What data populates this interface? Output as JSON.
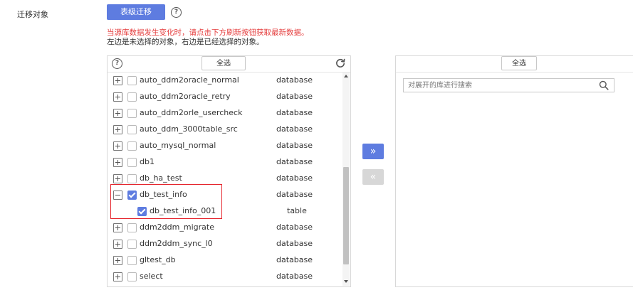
{
  "form": {
    "label": "迁移对象",
    "advanced_button": "表级迁移",
    "help_glyph": "?",
    "warning": "当源库数据发生变化时，请点击下方刷新按钮获取最新数据。",
    "info": "左边是未选择的对象，右边是已经选择的对象。"
  },
  "left_panel": {
    "help_glyph": "?",
    "select_all": "全选",
    "rows": [
      {
        "name": "auto_ddm2oracle_normal",
        "type": "database",
        "checked": false,
        "expanded": false
      },
      {
        "name": "auto_ddm2oracle_retry",
        "type": "database",
        "checked": false,
        "expanded": false
      },
      {
        "name": "auto_ddm2orle_usercheck",
        "type": "database",
        "checked": false,
        "expanded": false
      },
      {
        "name": "auto_ddm_3000table_src",
        "type": "database",
        "checked": false,
        "expanded": false
      },
      {
        "name": "auto_mysql_normal",
        "type": "database",
        "checked": false,
        "expanded": false
      },
      {
        "name": "db1",
        "type": "database",
        "checked": false,
        "expanded": false
      },
      {
        "name": "db_ha_test",
        "type": "database",
        "checked": false,
        "expanded": false
      },
      {
        "name": "db_test_info",
        "type": "database",
        "checked": true,
        "expanded": true
      },
      {
        "name": "db_test_info_001",
        "type": "table",
        "checked": true,
        "child": true
      },
      {
        "name": "ddm2ddm_migrate",
        "type": "database",
        "checked": false,
        "expanded": false
      },
      {
        "name": "ddm2ddm_sync_l0",
        "type": "database",
        "checked": false,
        "expanded": false
      },
      {
        "name": "gltest_db",
        "type": "database",
        "checked": false,
        "expanded": false
      },
      {
        "name": "select",
        "type": "database",
        "checked": false,
        "expanded": false
      }
    ]
  },
  "transfer": {
    "move_right": "»",
    "move_left": "«"
  },
  "right_panel": {
    "select_all": "全选",
    "search_placeholder": "对展开的库进行搜索"
  },
  "colors": {
    "primary": "#5e7ce0",
    "warning": "#e53e3e",
    "highlight": "#e5252d"
  }
}
